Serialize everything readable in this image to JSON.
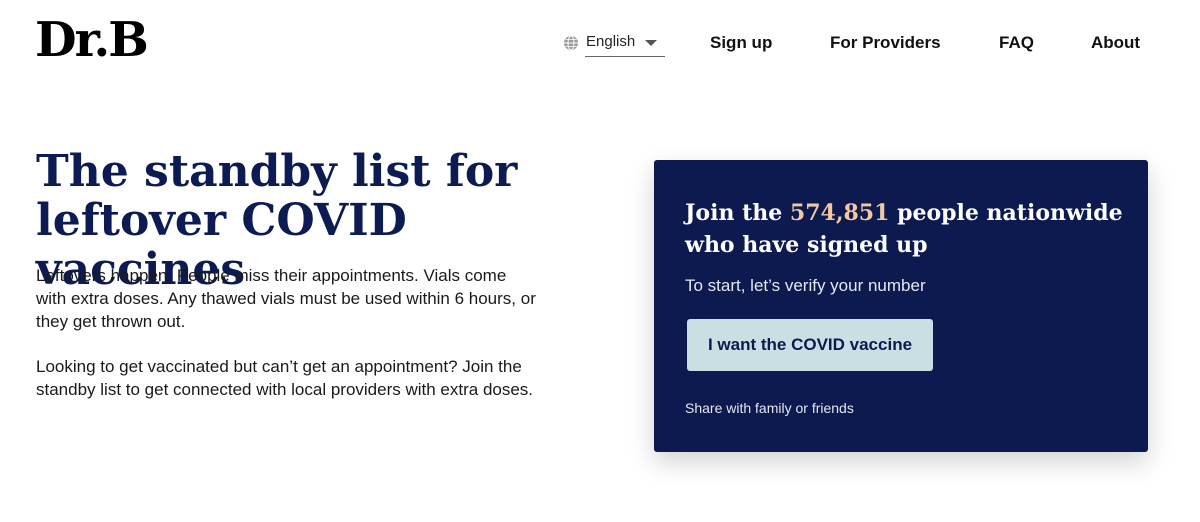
{
  "header": {
    "logo": "Dr.B",
    "language": {
      "selected": "English"
    },
    "nav": {
      "signup": "Sign up",
      "providers": "For Providers",
      "faq": "FAQ",
      "about": "About"
    }
  },
  "hero": {
    "title": "The standby list for leftover COVID vaccines",
    "paragraph1": "Leftovers happen. People miss their appointments. Vials come with extra doses. Any thawed vials must be used within 6 hours, or they get thrown out.",
    "paragraph2": "Looking to get vaccinated but can’t get an appointment? Join the standby list to get connected with local providers with extra doses."
  },
  "card": {
    "title_prefix": "Join the ",
    "signup_count": "574,851",
    "title_suffix": " people nationwide who have signed up",
    "subtitle": "To start, let’s verify your number",
    "cta_label": "I want the COVID vaccine",
    "share_label": "Share with family or friends"
  },
  "colors": {
    "brand_navy": "#0c1a4f",
    "headline_navy": "#0c1c52",
    "count_highlight": "#f2c9a5",
    "button_bg": "#c9dfe3"
  },
  "icons": {
    "language": "globe-icon",
    "dropdown": "caret-down-icon"
  }
}
